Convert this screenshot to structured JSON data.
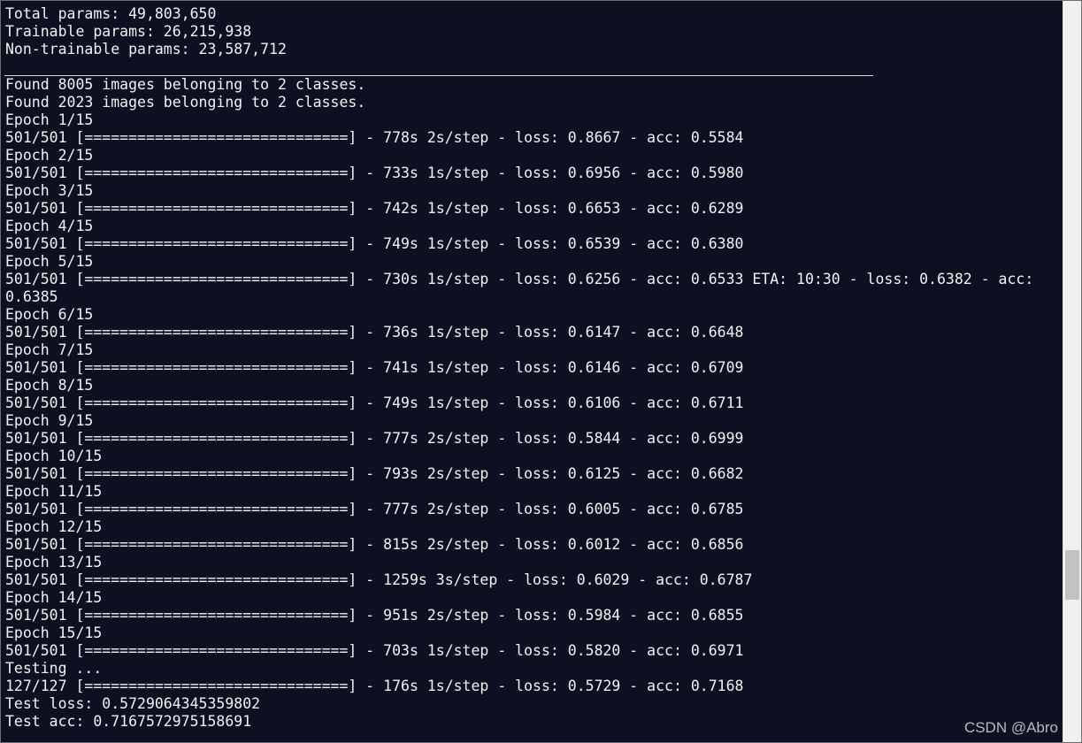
{
  "terminal": {
    "lines": [
      "Total params: 49,803,650",
      "Trainable params: 26,215,938",
      "Non-trainable params: 23,587,712",
      "",
      "Found 8005 images belonging to 2 classes.",
      "Found 2023 images belonging to 2 classes.",
      "Epoch 1/15",
      "501/501 [==============================] - 778s 2s/step - loss: 0.8667 - acc: 0.5584",
      "Epoch 2/15",
      "501/501 [==============================] - 733s 1s/step - loss: 0.6956 - acc: 0.5980",
      "Epoch 3/15",
      "501/501 [==============================] - 742s 1s/step - loss: 0.6653 - acc: 0.6289",
      "Epoch 4/15",
      "501/501 [==============================] - 749s 1s/step - loss: 0.6539 - acc: 0.6380",
      "Epoch 5/15",
      "501/501 [==============================] - 730s 1s/step - loss: 0.6256 - acc: 0.6533 ETA: 10:30 - loss: 0.6382 - acc:",
      "0.6385",
      "Epoch 6/15",
      "501/501 [==============================] - 736s 1s/step - loss: 0.6147 - acc: 0.6648",
      "Epoch 7/15",
      "501/501 [==============================] - 741s 1s/step - loss: 0.6146 - acc: 0.6709",
      "Epoch 8/15",
      "501/501 [==============================] - 749s 1s/step - loss: 0.6106 - acc: 0.6711",
      "Epoch 9/15",
      "501/501 [==============================] - 777s 2s/step - loss: 0.5844 - acc: 0.6999",
      "Epoch 10/15",
      "501/501 [==============================] - 793s 2s/step - loss: 0.6125 - acc: 0.6682",
      "Epoch 11/15",
      "501/501 [==============================] - 777s 2s/step - loss: 0.6005 - acc: 0.6785",
      "Epoch 12/15",
      "501/501 [==============================] - 815s 2s/step - loss: 0.6012 - acc: 0.6856",
      "Epoch 13/15",
      "501/501 [==============================] - 1259s 3s/step - loss: 0.6029 - acc: 0.6787",
      "Epoch 14/15",
      "501/501 [==============================] - 951s 2s/step - loss: 0.5984 - acc: 0.6855",
      "Epoch 15/15",
      "501/501 [==============================] - 703s 1s/step - loss: 0.5820 - acc: 0.6971",
      "Testing ...",
      "127/127 [==============================] - 176s 1s/step - loss: 0.5729 - acc: 0.7168",
      "Test loss: 0.5729064345359802",
      "Test acc: 0.7167572975158691"
    ]
  },
  "watermark": "CSDN @Abro",
  "colors": {
    "background": "#0c1021",
    "text": "#f2f2f2",
    "scrollbar": "#f0f0f0",
    "scroll_thumb": "#c2c2c2"
  }
}
